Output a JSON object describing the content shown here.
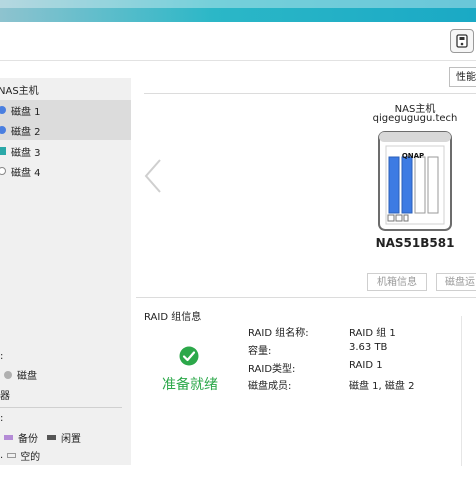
{
  "toolbar": {
    "icon": "device-icon"
  },
  "sidebar": {
    "title": "NAS主机",
    "disks": [
      {
        "label": "磁盘 1",
        "color": "#4a7fe0",
        "shape": "dot",
        "selected": true
      },
      {
        "label": "磁盘 2",
        "color": "#4a7fe0",
        "shape": "dot",
        "selected": true
      },
      {
        "label": "磁盘 3",
        "color": "#2aa8a8",
        "shape": "square",
        "selected": false
      },
      {
        "label": "磁盘 4",
        "color": "#ffffff",
        "shape": "dot",
        "selected": false
      }
    ],
    "legend1": {
      "heading": ":",
      "items": [
        {
          "label": "磁盘",
          "color": "#b0b0b0"
        }
      ]
    },
    "legend_section": "器",
    "legend2": {
      "heading": ":",
      "items": [
        {
          "label": "备份",
          "color": "#b48bd6"
        },
        {
          "label": "闲置",
          "color": "#555555"
        }
      ],
      "items_row2": [
        {
          "prefix": ".",
          "label": "空的"
        }
      ]
    }
  },
  "main": {
    "tab_label": "性能",
    "nas_label": "NAS主机",
    "host_name": "qigegugugu.tech",
    "brand": "QNAP",
    "model": "NAS51B581",
    "buttons": {
      "chassis": "机箱信息",
      "disk": "磁盘运"
    },
    "raid": {
      "section_title": "RAID 组信息",
      "status": "准备就绪",
      "status_color": "#2ca84a",
      "fields": [
        {
          "label": "RAID 组名称:",
          "value": "RAID 组 1"
        },
        {
          "label": "容量:",
          "value": "3.63 TB"
        },
        {
          "label": "RAID类型:",
          "value": "RAID 1"
        },
        {
          "label": "磁盘成员:",
          "value": "磁盘 1, 磁盘 2"
        }
      ]
    }
  }
}
